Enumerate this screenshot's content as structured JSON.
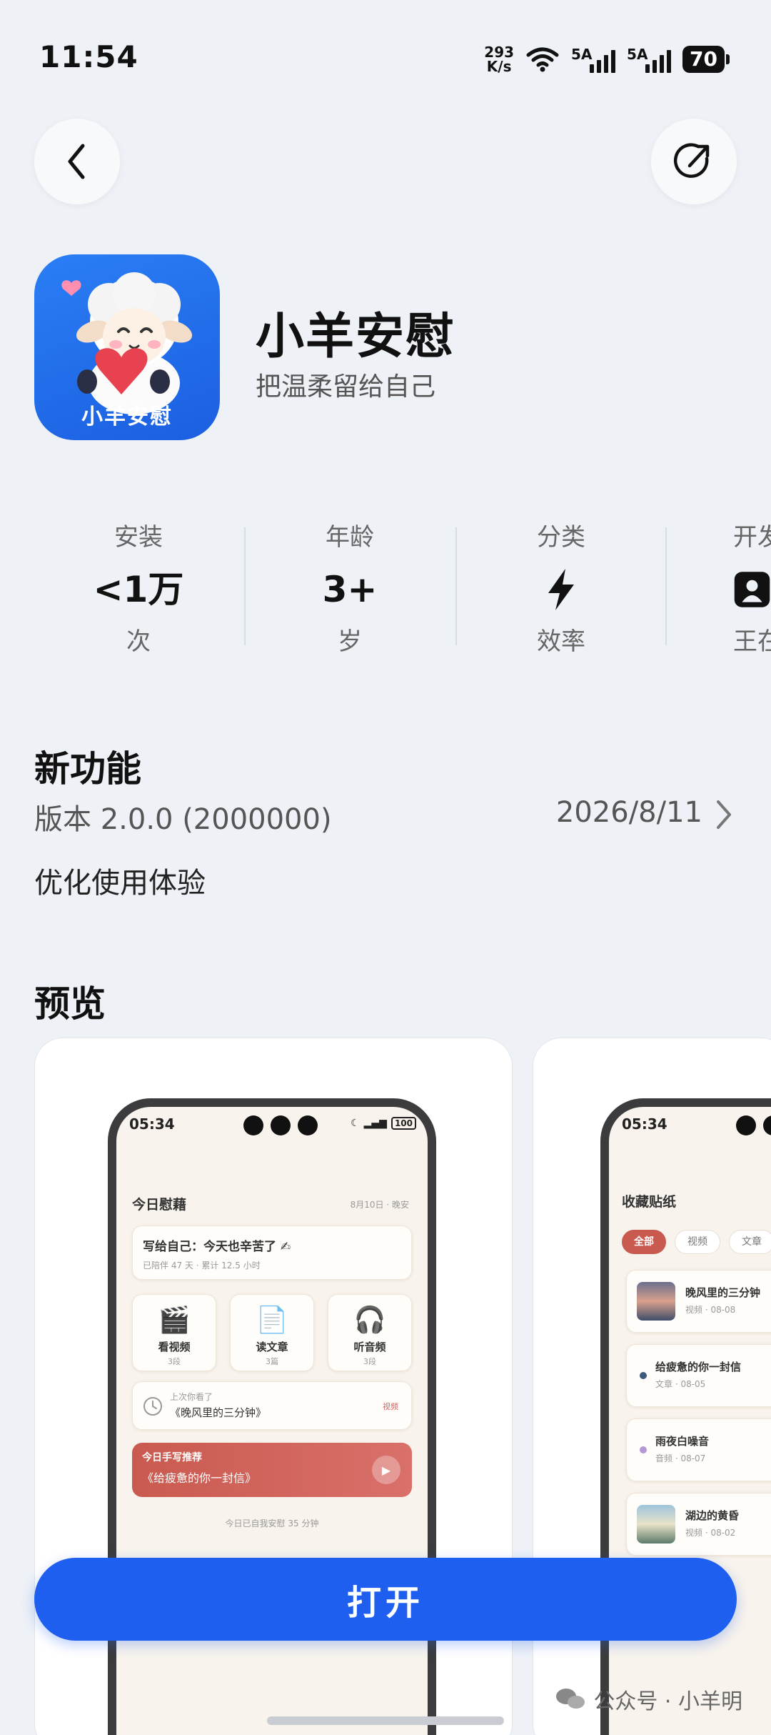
{
  "status_bar": {
    "time": "11:54",
    "net_speed_value": "293",
    "net_speed_unit": "K/s",
    "sim1_label": "5A",
    "sim2_label": "5A",
    "battery": "70"
  },
  "app": {
    "name": "小羊安慰",
    "slogan": "把温柔留给自己",
    "icon_text": "小羊安慰"
  },
  "stats": [
    {
      "label": "安装",
      "value": "<1万",
      "sub": "次"
    },
    {
      "label": "年龄",
      "value": "3+",
      "sub": "岁"
    },
    {
      "label": "分类",
      "value_icon": "lightning-icon",
      "sub": "效率"
    },
    {
      "label": "开发",
      "value_icon": "developer-icon",
      "sub": "王在"
    }
  ],
  "whats_new": {
    "title": "新功能",
    "version": "版本 2.0.0 (2000000)",
    "date": "2026/8/11",
    "changes": "优化使用体验"
  },
  "preview": {
    "title": "预览",
    "screen1": {
      "time": "05:34",
      "battery": "100",
      "heading": "今日慰藉",
      "date": "8月10日 · 晚安",
      "note_title": "写给自己：今天也辛苦了 ✍",
      "note_sub": "已陪伴 47 天 · 累计 12.5 小时",
      "tiles": [
        {
          "icon": "🎬",
          "name": "看视频",
          "count": "3段"
        },
        {
          "icon": "📄",
          "name": "读文章",
          "count": "3篇"
        },
        {
          "icon": "🎧",
          "name": "听音频",
          "count": "3段"
        }
      ],
      "last_label": "上次你看了",
      "last_title": "《晚风里的三分钟》",
      "last_tag": "视频",
      "rec_label": "今日手写推荐",
      "rec_title": "《给疲惫的你一封信》",
      "footer": "今日已自我安慰 35 分钟"
    },
    "screen2": {
      "time": "05:34",
      "heading": "收藏贴纸",
      "chips": [
        "全部",
        "视频",
        "文章"
      ],
      "items": [
        {
          "title": "晚风里的三分钟",
          "meta": "视频 · 08-08"
        },
        {
          "title": "给疲惫的你一封信",
          "meta": "文章 · 08-05"
        },
        {
          "title": "雨夜白噪音",
          "meta": "音频 · 08-07"
        },
        {
          "title": "湖边的黄昏",
          "meta": "视频 · 08-02"
        }
      ]
    }
  },
  "open_button_label": "打开",
  "watermark": "公众号 · 小羊明",
  "colors": {
    "accent": "#1f5ff0",
    "background": "#eef1f6",
    "preview_red": "#c95a4f"
  }
}
